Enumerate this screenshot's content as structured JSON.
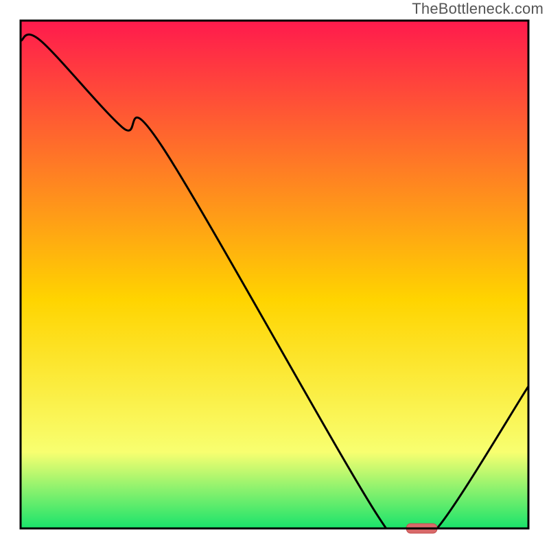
{
  "watermark": {
    "text": "TheBottleneck.com"
  },
  "colors": {
    "gradient_top": "#ff1a4d",
    "gradient_mid": "#ffd400",
    "gradient_low": "#f8ff70",
    "gradient_green": "#19e36b",
    "frame": "#000000",
    "curve": "#000000",
    "marker_fill": "#d96a6a",
    "marker_stroke": "#c24f4f"
  },
  "chart_data": {
    "type": "line",
    "title": "",
    "xlabel": "",
    "ylabel": "",
    "xlim": [
      0,
      100
    ],
    "ylim": [
      0,
      100
    ],
    "x": [
      0,
      4,
      20,
      28,
      70,
      76,
      82,
      100
    ],
    "values": [
      96,
      96,
      79,
      75,
      3,
      0,
      0,
      28
    ],
    "marker": {
      "x0": 76,
      "x1": 82,
      "y": 0
    },
    "note": "Axis units are abstract 0–100 because the source chart has no tick marks or axis labels. Values are read off the plotted curve relative to the frame; the curve falls from top-left, flattens to zero around x≈76–82 (where the marker sits), then rises toward the right edge."
  }
}
